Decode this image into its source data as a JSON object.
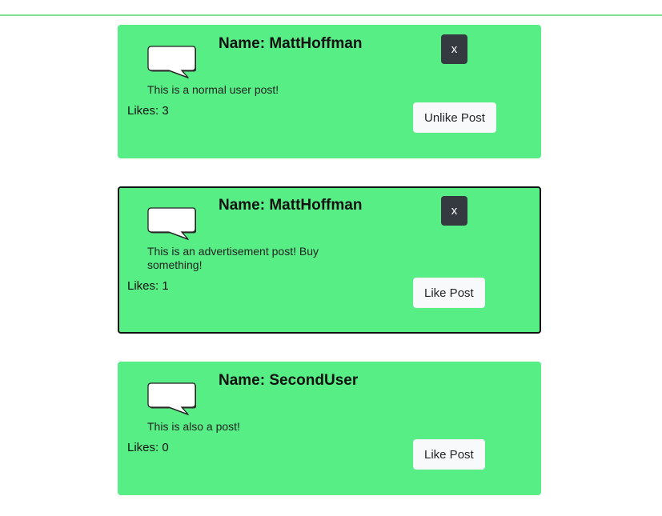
{
  "posts": [
    {
      "name": "Name: MattHoffman",
      "delete_label": "x",
      "text": "This is a normal user post!",
      "likes": "Likes: 3",
      "like_button_label": "Unlike Post",
      "bubble_icon": "speech-bubble-icon"
    },
    {
      "name": "Name: MattHoffman",
      "delete_label": "x",
      "text": "This is an advertisement post! Buy something!",
      "likes": "Likes: 1",
      "like_button_label": "Like Post",
      "bubble_icon": "speech-bubble-icon"
    },
    {
      "name": "Name: SecondUser",
      "text": "This is also a post!",
      "likes": "Likes: 0",
      "like_button_label": "Like Post",
      "bubble_icon": "speech-bubble-icon"
    }
  ],
  "colors": {
    "post_background": "#57ee86",
    "top_rule": "#7fe39a",
    "delete_button": "#343a40",
    "ad_border": "#111111"
  }
}
